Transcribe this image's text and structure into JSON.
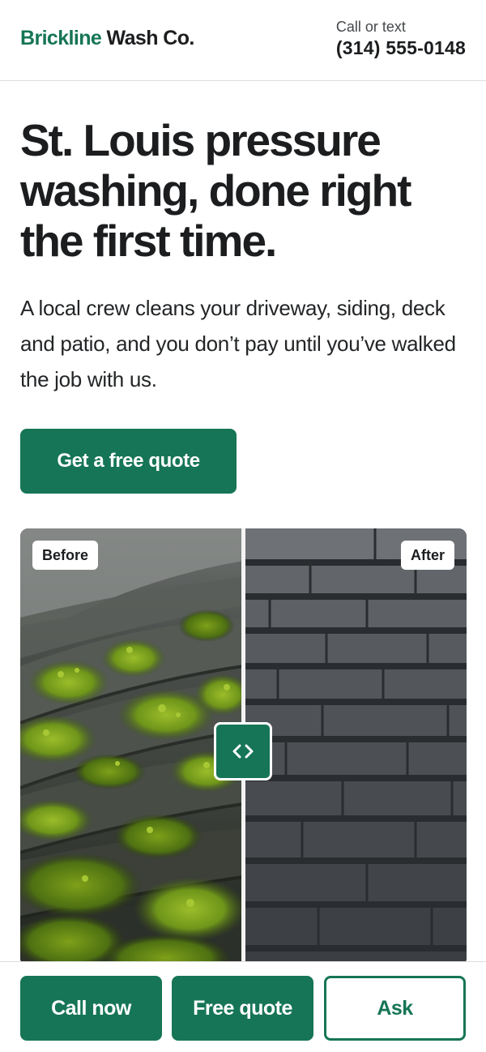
{
  "header": {
    "brand_first": "Brickline",
    "brand_rest": " Wash Co.",
    "call_label": "Call or text",
    "phone": "(314) 555-0148"
  },
  "hero": {
    "headline": "St. Louis pressure washing, done right the first time.",
    "lede": "A local crew cleans your driveway, siding, deck and patio, and you don’t pay until you’ve walked the job with us.",
    "cta_label": "Get a free quote"
  },
  "comparison": {
    "before_label": "Before",
    "after_label": "After",
    "slider_position_percent": 50,
    "handle_icon": "chevrons-left-right-icon",
    "before_image": "mossy-roof-shingles",
    "after_image": "clean-roof-shingles"
  },
  "bottom_bar": {
    "call_label": "Call now",
    "quote_label": "Free quote",
    "ask_label": "Ask"
  },
  "colors": {
    "brand_green": "#167556",
    "text_dark": "#1b1d1f",
    "border": "#dedede"
  }
}
